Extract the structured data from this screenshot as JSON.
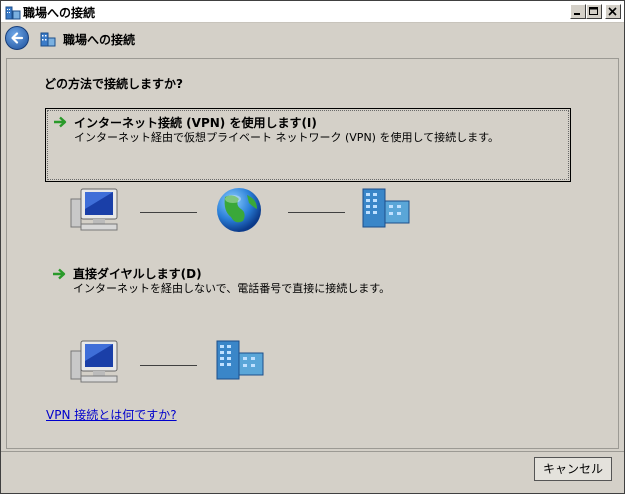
{
  "window": {
    "title": "職場への接続"
  },
  "nav": {
    "title": "職場への接続"
  },
  "main": {
    "question": "どの方法で接続しますか?",
    "options": [
      {
        "title": "インターネット接続 (VPN) を使用します(I)",
        "description": "インターネット経由で仮想プライベート ネットワーク (VPN) を使用して接続します。",
        "arrow_icon": "green-arrow-icon"
      },
      {
        "title": "直接ダイヤルします(D)",
        "description": "インターネットを経由しないで、電話番号で直接に接続します。",
        "arrow_icon": "green-arrow-icon"
      }
    ],
    "help_link": "VPN 接続とは何ですか?"
  },
  "footer": {
    "cancel_label": "キャンセル"
  },
  "colors": {
    "link": "#0000cc",
    "arrow": "#2a9a2a",
    "window_bg": "#d4d0c8"
  }
}
